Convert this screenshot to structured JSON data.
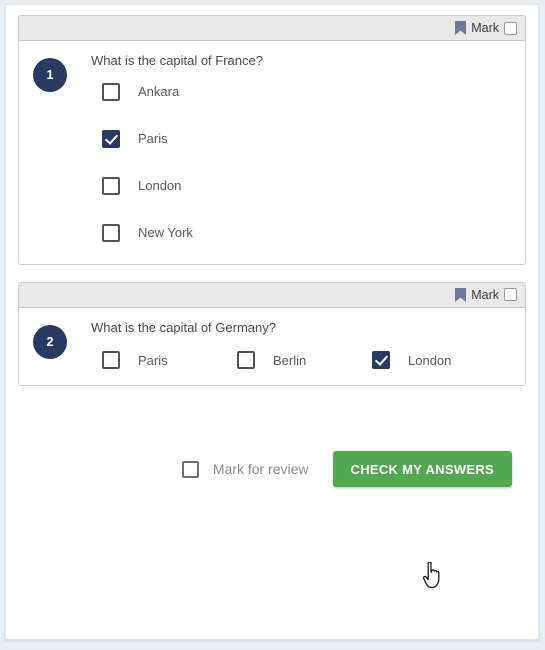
{
  "colors": {
    "page_background": "#e9eef3",
    "card_background": "#ffffff",
    "question_header": "#e8e8e8",
    "badge_navy": "#2b3a63",
    "checkbox_checked": "#2b3a63",
    "bookmark": "#6b7a99",
    "submit_green": "#51a84f"
  },
  "questions": [
    {
      "number": "1",
      "mark_label": "Mark",
      "text": "What is the capital of France?",
      "layout": "vertical",
      "options": [
        {
          "label": "Ankara",
          "checked": false
        },
        {
          "label": "Paris",
          "checked": true
        },
        {
          "label": "London",
          "checked": false
        },
        {
          "label": "New York",
          "checked": false
        }
      ]
    },
    {
      "number": "2",
      "mark_label": "Mark",
      "text": "What is the capital of Germany?",
      "layout": "horizontal",
      "options": [
        {
          "label": "Paris",
          "checked": false
        },
        {
          "label": "Berlin",
          "checked": false
        },
        {
          "label": "London",
          "checked": true
        }
      ]
    }
  ],
  "footer": {
    "review_label": "Mark for review",
    "review_checked": false,
    "submit_label": "CHECK MY ANSWERS"
  }
}
